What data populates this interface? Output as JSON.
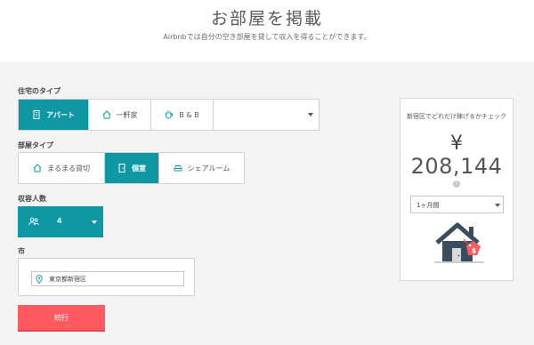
{
  "header": {
    "title": "お部屋を掲載",
    "subtitle": "Airbnbでは自分の空き部屋を貸して収入を得ることができます。"
  },
  "home_type": {
    "label": "住宅のタイプ",
    "options": [
      "アパート",
      "一軒家",
      "B & B"
    ],
    "selected": "アパート"
  },
  "room_type": {
    "label": "部屋タイプ",
    "options": [
      "まるまる貸切",
      "個室",
      "シェアルーム"
    ],
    "selected": "個室"
  },
  "guests": {
    "label": "収容人数",
    "value": "4"
  },
  "city": {
    "label": "市",
    "value": "東京都新宿区"
  },
  "continue_label": "続行",
  "estimate": {
    "title": "新宿区でどれだけ稼げるかチェック",
    "currency": "¥",
    "amount": "208,144",
    "help": "?",
    "period": "1ヶ月間"
  },
  "colors": {
    "accent": "#0f97a4",
    "cta": "#ff5a5f"
  }
}
